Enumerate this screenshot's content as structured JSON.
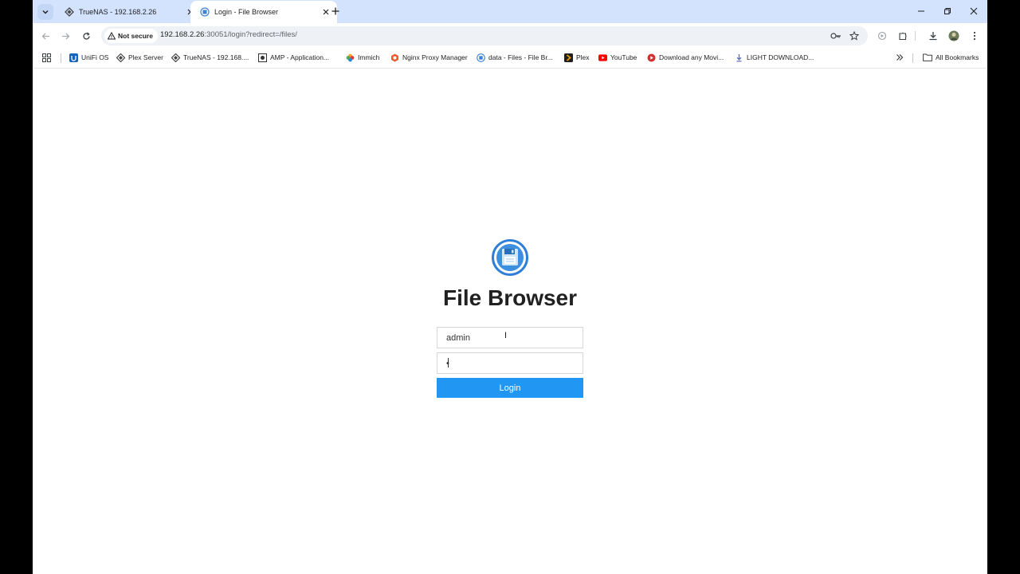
{
  "tabs": [
    {
      "title": "TrueNAS - 192.168.2.26",
      "active": false
    },
    {
      "title": "Login - File Browser",
      "active": true
    }
  ],
  "toolbar": {
    "security_label": "Not secure",
    "url_host": "192.168.2.26",
    "url_path": ":30051/login?redirect=/files/"
  },
  "bookmarks": [
    {
      "label": "UniFi OS",
      "icon": "unifi-icon"
    },
    {
      "label": "Plex Server",
      "icon": "plex-server-icon"
    },
    {
      "label": "TrueNAS - 192.168....",
      "icon": "truenas-icon"
    },
    {
      "label": "AMP - Application...",
      "icon": "amp-icon"
    },
    {
      "label": "Immich",
      "icon": "immich-icon"
    },
    {
      "label": "Nginx Proxy Manager",
      "icon": "nginx-icon"
    },
    {
      "label": "data - Files - File Br...",
      "icon": "filebrowser-icon"
    },
    {
      "label": "Plex",
      "icon": "plex-icon"
    },
    {
      "label": "YouTube",
      "icon": "youtube-icon"
    },
    {
      "label": "Download any Movi...",
      "icon": "download-movie-icon"
    },
    {
      "label": "LIGHT DOWNLOAD...",
      "icon": "light-download-icon"
    }
  ],
  "all_bookmarks_label": "All Bookmarks",
  "login": {
    "title": "File Browser",
    "username_value": "admin",
    "password_value": "•",
    "button_label": "Login"
  },
  "colors": {
    "accent": "#2196f3",
    "tabstrip": "#d3e3fd"
  }
}
